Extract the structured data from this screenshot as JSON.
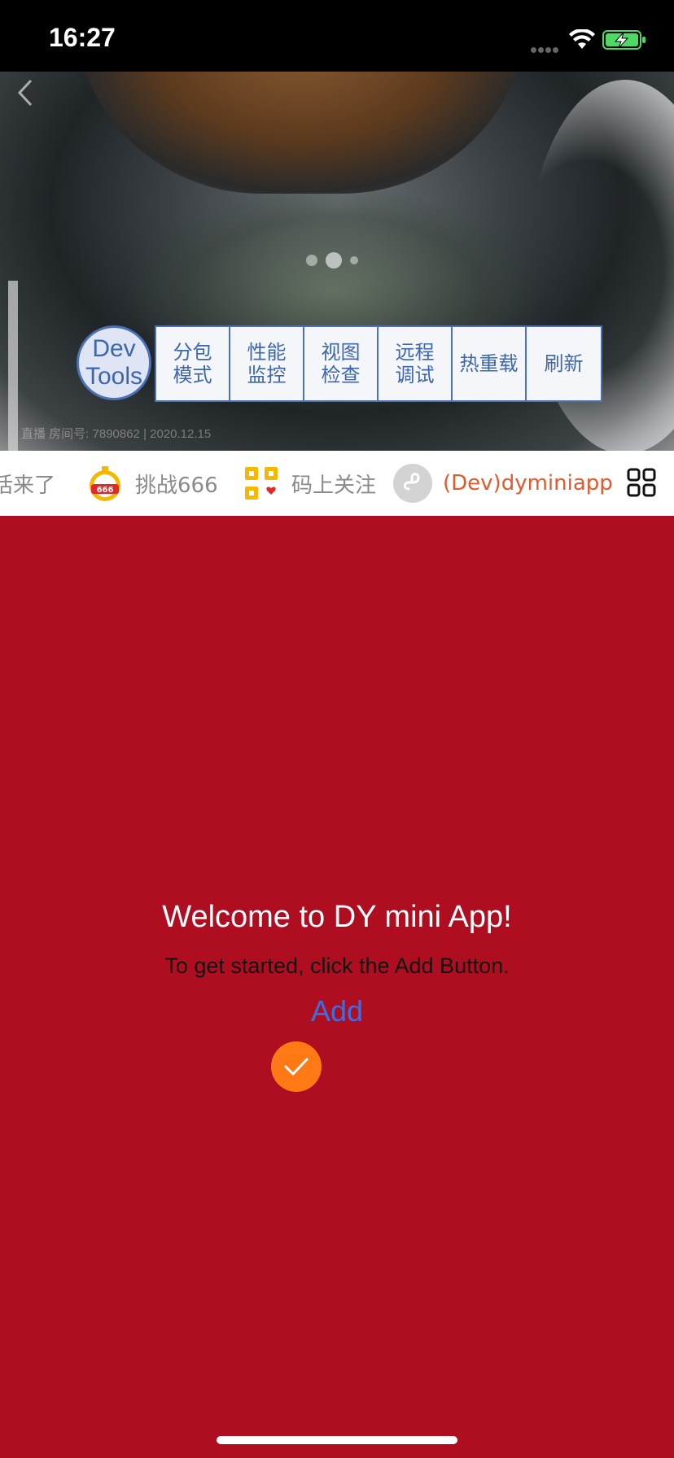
{
  "status_bar": {
    "time": "16:27"
  },
  "banner": {
    "room_info": "直播 房间号: 7890862 | 2020.12.15"
  },
  "devtools": {
    "label_line1": "Dev",
    "label_line2": "Tools",
    "menu": [
      {
        "line1": "分包",
        "line2": "模式"
      },
      {
        "line1": "性能",
        "line2": "监控"
      },
      {
        "line1": "视图",
        "line2": "检查"
      },
      {
        "line1": "远程",
        "line2": "调试"
      },
      {
        "line1": "热重载",
        "line2": ""
      },
      {
        "line1": "刷新",
        "line2": ""
      }
    ]
  },
  "shortcuts": [
    {
      "label": "话来了",
      "icon": "partial-icon"
    },
    {
      "label": "挑战666",
      "icon": "stopwatch-666-icon"
    },
    {
      "label": "码上关注",
      "icon": "qr-code-icon"
    },
    {
      "label": "(Dev)dyminiapp",
      "icon": "mini-app-link-icon"
    }
  ],
  "main": {
    "title": "Welcome to DY mini App!",
    "subtitle": "To get started, click the Add Button.",
    "add_label": "Add"
  },
  "colors": {
    "page_background": "#ae0e20",
    "devtools_blue": "#4a72b4",
    "active_shortcut": "#e2592d",
    "add_link": "#3b6fe6",
    "check_button": "#ff7a14"
  }
}
